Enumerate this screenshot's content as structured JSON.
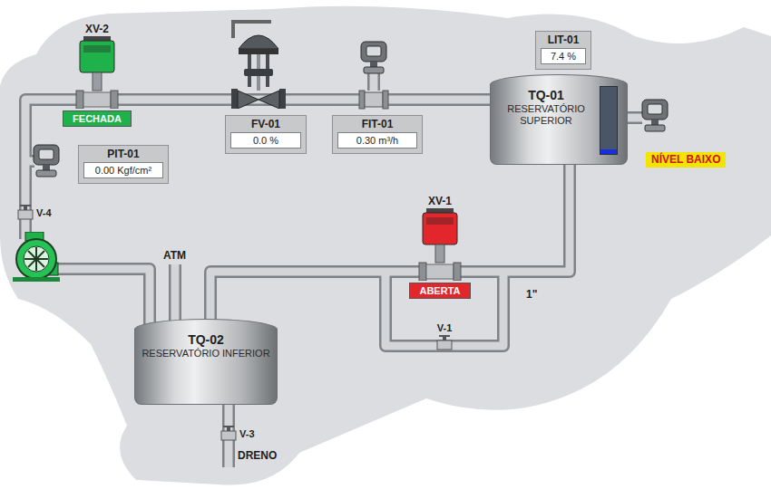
{
  "valves": [
    {
      "tag": "XV-2",
      "status": "FECHADA",
      "color": "#1fb24a"
    },
    {
      "tag": "XV-1",
      "status": "ABERTA",
      "color": "#e3262b"
    }
  ],
  "instruments": [
    {
      "tag": "FV-01",
      "value": "0.0 %"
    },
    {
      "tag": "FIT-01",
      "value": "0.30 m³/h"
    },
    {
      "tag": "PIT-01",
      "value": "0.00 Kgf/cm²"
    },
    {
      "tag": "LIT-01",
      "value": "7.4 %"
    }
  ],
  "tanks": [
    {
      "tag": "TQ-01",
      "name": "RESERVATÓRIO SUPERIOR",
      "level": 0.074
    },
    {
      "tag": "TQ-02",
      "name": "RESERVATÓRIO INFERIOR"
    }
  ],
  "alarm": {
    "text": "NÍVEL BAIXO",
    "active": true
  },
  "pump": {
    "running": true
  },
  "manual_valves": [
    {
      "tag": "V-4"
    },
    {
      "tag": "V-1"
    },
    {
      "tag": "V-3"
    }
  ],
  "labels": {
    "vent": "ATM",
    "drain": "DRENO",
    "pipe_size": "1\""
  }
}
